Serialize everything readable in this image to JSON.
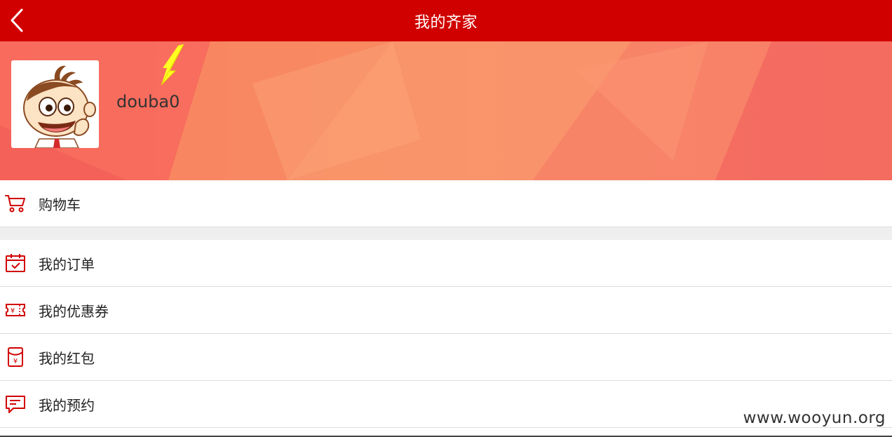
{
  "header": {
    "title": "我的齐家",
    "back_icon": "chevron-left-icon",
    "background_color": "#d10000"
  },
  "profile": {
    "username": "douba0",
    "avatar_icon": "cartoon-avatar-icon"
  },
  "menu": {
    "items": [
      {
        "label": "购物车",
        "icon": "cart-icon"
      },
      {
        "label": "我的订单",
        "icon": "calendar-check-icon"
      },
      {
        "label": "我的优惠券",
        "icon": "coupon-icon"
      },
      {
        "label": "我的红包",
        "icon": "red-envelope-icon"
      },
      {
        "label": "我的预约",
        "icon": "message-icon"
      }
    ]
  },
  "watermark": "www.wooyun.org",
  "colors": {
    "accent": "#d10000",
    "icon": "#d10000",
    "profile_bg": "#f8875f",
    "annotation_arrow": "#ffff00"
  }
}
